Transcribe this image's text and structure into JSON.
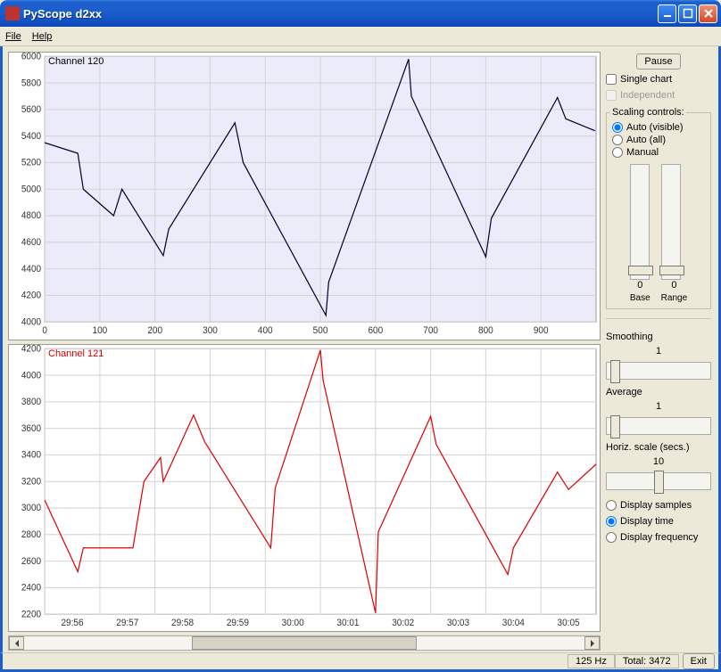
{
  "window": {
    "title": "PyScope d2xx"
  },
  "menubar": {
    "file": "File",
    "help": "Help"
  },
  "charts": {
    "ch1": {
      "title": "Channel 120"
    },
    "ch2": {
      "title": "Channel 121"
    }
  },
  "sidepanel": {
    "pause": "Pause",
    "single_chart": "Single chart",
    "independent": "Independent",
    "scaling_legend": "Scaling controls:",
    "auto_visible": "Auto (visible)",
    "auto_all": "Auto (all)",
    "manual": "Manual",
    "base_val": "0",
    "range_val": "0",
    "base_label": "Base",
    "range_label": "Range",
    "smoothing_label": "Smoothing",
    "smoothing_val": "1",
    "average_label": "Average",
    "average_val": "1",
    "horiz_label": "Horiz. scale (secs.)",
    "horiz_val": "10",
    "display_samples": "Display samples",
    "display_time": "Display time",
    "display_frequency": "Display frequency"
  },
  "statusbar": {
    "hz": "125 Hz",
    "total": "Total: 3472",
    "exit": "Exit"
  },
  "chart_data": [
    {
      "type": "line",
      "title": "Channel 120",
      "xlabel": "",
      "ylabel": "",
      "ylim": [
        4000,
        6000
      ],
      "xlim": [
        0,
        1000
      ],
      "x_ticks": [
        0,
        100,
        200,
        300,
        400,
        500,
        600,
        700,
        800,
        900
      ],
      "y_ticks": [
        4000,
        4200,
        4400,
        4600,
        4800,
        5000,
        5200,
        5400,
        5600,
        5800,
        6000
      ],
      "series": [
        {
          "name": "Channel 120",
          "color": "#000033",
          "x": [
            0,
            60,
            70,
            125,
            140,
            215,
            225,
            345,
            360,
            510,
            515,
            660,
            665,
            800,
            810,
            930,
            945,
            998
          ],
          "values": [
            5350,
            5270,
            5000,
            4800,
            5000,
            4500,
            4700,
            5500,
            5200,
            4050,
            4300,
            5980,
            5700,
            4490,
            4780,
            5690,
            5530,
            5440
          ]
        }
      ]
    },
    {
      "type": "line",
      "title": "Channel 121",
      "xlabel": "",
      "ylabel": "",
      "ylim": [
        2200,
        4200
      ],
      "x_ticks_labels": [
        "29:56",
        "29:57",
        "29:58",
        "29:59",
        "30:00",
        "30:01",
        "30:02",
        "30:03",
        "30:04",
        "30:05"
      ],
      "y_ticks": [
        2200,
        2400,
        2600,
        2800,
        3000,
        3200,
        3400,
        3600,
        3800,
        4000,
        4200
      ],
      "series": [
        {
          "name": "Channel 121",
          "color": "#d00",
          "x": [
            0.0,
            0.6,
            0.7,
            1.6,
            1.8,
            2.1,
            2.15,
            2.7,
            2.9,
            4.1,
            4.18,
            5.0,
            5.05,
            6.0,
            6.05,
            7.0,
            7.1,
            8.4,
            8.5,
            9.3,
            9.5,
            10.0
          ],
          "values": [
            3060,
            2520,
            2700,
            2700,
            3200,
            3380,
            3200,
            3700,
            3500,
            2700,
            3150,
            4190,
            3960,
            2210,
            2820,
            3690,
            3480,
            2500,
            2700,
            3270,
            3140,
            3330
          ]
        }
      ]
    }
  ]
}
